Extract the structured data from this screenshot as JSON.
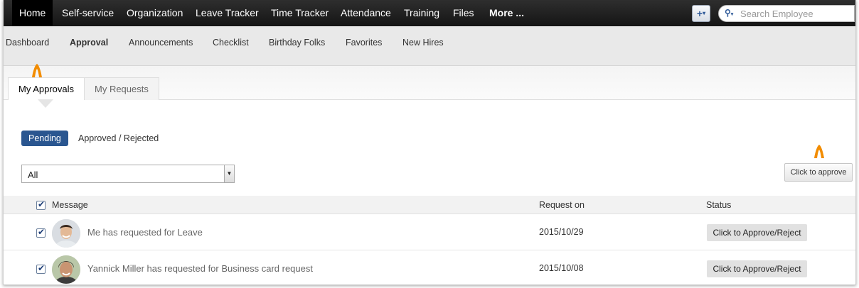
{
  "topnav": {
    "items": [
      "Home",
      "Self-service",
      "Organization",
      "Leave Tracker",
      "Time Tracker",
      "Attendance",
      "Training",
      "Files",
      "More ..."
    ],
    "add_label": "+",
    "search_placeholder": "Search Employee"
  },
  "subnav": {
    "items": [
      "Dashboard",
      "Approval",
      "Announcements",
      "Checklist",
      "Birthday Folks",
      "Favorites",
      "New Hires"
    ]
  },
  "tabs": [
    "My Approvals",
    "My Requests"
  ],
  "filters": {
    "pending": "Pending",
    "approved_rejected": "Approved / Rejected"
  },
  "select": {
    "value": "All"
  },
  "approve_button": "Click to approve",
  "table": {
    "headers": {
      "message": "Message",
      "request_on": "Request on",
      "status": "Status"
    },
    "rows": [
      {
        "message": "Me has requested for Leave",
        "date": "2015/10/29",
        "status": "Click to Approve/Reject"
      },
      {
        "message": "Yannick Miller has requested for Business card request",
        "date": "2015/10/08",
        "status": "Click to Approve/Reject"
      }
    ]
  },
  "colors": {
    "accent": "#2a5690",
    "highlight_arrow": "#f28c00",
    "topbar": "#1f1f1f"
  }
}
